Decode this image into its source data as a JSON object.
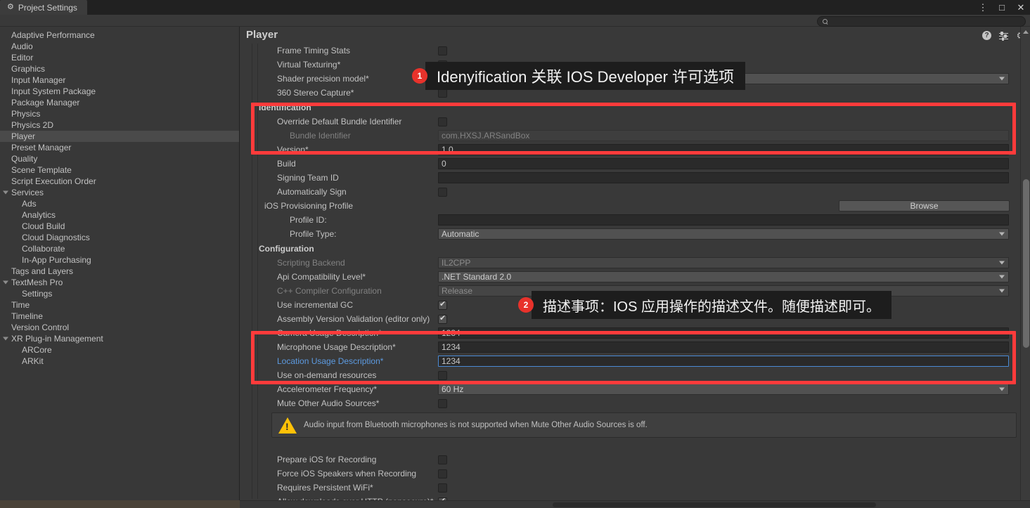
{
  "window": {
    "tab_label": "Project Settings",
    "tab_icon": "gear-icon",
    "menu_icon": "⋮",
    "maximize_icon": "□",
    "close_icon": "✕"
  },
  "search": {
    "value": "",
    "placeholder": "",
    "icon": "search-icon"
  },
  "sidebar": {
    "items": [
      {
        "label": "Adaptive Performance",
        "level": 0,
        "selected": false,
        "expandable": false
      },
      {
        "label": "Audio",
        "level": 0,
        "selected": false,
        "expandable": false
      },
      {
        "label": "Editor",
        "level": 0,
        "selected": false,
        "expandable": false
      },
      {
        "label": "Graphics",
        "level": 0,
        "selected": false,
        "expandable": false
      },
      {
        "label": "Input Manager",
        "level": 0,
        "selected": false,
        "expandable": false
      },
      {
        "label": "Input System Package",
        "level": 0,
        "selected": false,
        "expandable": false
      },
      {
        "label": "Package Manager",
        "level": 0,
        "selected": false,
        "expandable": false
      },
      {
        "label": "Physics",
        "level": 0,
        "selected": false,
        "expandable": false
      },
      {
        "label": "Physics 2D",
        "level": 0,
        "selected": false,
        "expandable": false
      },
      {
        "label": "Player",
        "level": 0,
        "selected": true,
        "expandable": false
      },
      {
        "label": "Preset Manager",
        "level": 0,
        "selected": false,
        "expandable": false
      },
      {
        "label": "Quality",
        "level": 0,
        "selected": false,
        "expandable": false
      },
      {
        "label": "Scene Template",
        "level": 0,
        "selected": false,
        "expandable": false
      },
      {
        "label": "Script Execution Order",
        "level": 0,
        "selected": false,
        "expandable": false
      },
      {
        "label": "Services",
        "level": 0,
        "selected": false,
        "expandable": true
      },
      {
        "label": "Ads",
        "level": 1,
        "selected": false,
        "expandable": false
      },
      {
        "label": "Analytics",
        "level": 1,
        "selected": false,
        "expandable": false
      },
      {
        "label": "Cloud Build",
        "level": 1,
        "selected": false,
        "expandable": false
      },
      {
        "label": "Cloud Diagnostics",
        "level": 1,
        "selected": false,
        "expandable": false
      },
      {
        "label": "Collaborate",
        "level": 1,
        "selected": false,
        "expandable": false
      },
      {
        "label": "In-App Purchasing",
        "level": 1,
        "selected": false,
        "expandable": false
      },
      {
        "label": "Tags and Layers",
        "level": 0,
        "selected": false,
        "expandable": false
      },
      {
        "label": "TextMesh Pro",
        "level": 0,
        "selected": false,
        "expandable": true
      },
      {
        "label": "Settings",
        "level": 1,
        "selected": false,
        "expandable": false
      },
      {
        "label": "Time",
        "level": 0,
        "selected": false,
        "expandable": false
      },
      {
        "label": "Timeline",
        "level": 0,
        "selected": false,
        "expandable": false
      },
      {
        "label": "Version Control",
        "level": 0,
        "selected": false,
        "expandable": false
      },
      {
        "label": "XR Plug-in Management",
        "level": 0,
        "selected": false,
        "expandable": true
      },
      {
        "label": "ARCore",
        "level": 1,
        "selected": false,
        "expandable": false
      },
      {
        "label": "ARKit",
        "level": 1,
        "selected": false,
        "expandable": false
      }
    ]
  },
  "panel": {
    "title": "Player",
    "help_icon": "?",
    "help_icon_name": "help-icon",
    "preset_icon_name": "preset-sliders-icon",
    "gear_icon": "⚙",
    "gear_icon_name": "settings-gear-icon"
  },
  "rows": {
    "frame_timing_stats": "Frame Timing Stats",
    "virtual_texturing": "Virtual Texturing*",
    "shader_precision_model": "Shader precision model*",
    "stereo_360_capture": "360 Stereo Capture*",
    "identification_header": "Identification",
    "override_bundle_id": "Override Default Bundle Identifier",
    "bundle_identifier": "Bundle Identifier",
    "bundle_identifier_value": "com.HXSJ.ARSandBox",
    "version": "Version*",
    "version_value": "1.0",
    "build": "Build",
    "build_value": "0",
    "signing_team_id": "Signing Team ID",
    "signing_team_id_value": "",
    "automatically_sign": "Automatically Sign",
    "ios_provisioning_profile": "iOS Provisioning Profile",
    "browse_button": "Browse",
    "profile_id": "Profile ID:",
    "profile_id_value": "",
    "profile_type": "Profile Type:",
    "profile_type_value": "Automatic",
    "configuration_header": "Configuration",
    "scripting_backend": "Scripting Backend",
    "scripting_backend_value": "IL2CPP",
    "api_compat_level": "Api Compatibility Level*",
    "api_compat_level_value": ".NET Standard 2.0",
    "cpp_compiler_config": "C++ Compiler Configuration",
    "cpp_compiler_config_value": "Release",
    "use_incremental_gc": "Use incremental GC",
    "assembly_version_validation": "Assembly Version Validation (editor only)",
    "camera_usage": "Camera Usage Description*",
    "camera_usage_value": "1234",
    "microphone_usage": "Microphone Usage Description*",
    "microphone_usage_value": "1234",
    "location_usage": "Location Usage Description*",
    "location_usage_value": "1234",
    "use_on_demand_resources": "Use on-demand resources",
    "accelerometer_frequency": "Accelerometer Frequency*",
    "accelerometer_frequency_value": "60 Hz",
    "mute_other_audio": "Mute Other Audio Sources*",
    "audio_warning": "Audio input from Bluetooth microphones is not supported when Mute Other Audio Sources is off.",
    "prepare_ios_recording": "Prepare iOS for Recording",
    "force_ios_speakers": "Force iOS Speakers when Recording",
    "requires_persistent_wifi": "Requires Persistent WiFi*",
    "allow_http_downloads": "Allow downloads over HTTP (nonsecure)*"
  },
  "callouts": [
    {
      "number": "1",
      "text": "Idenyification 关联 IOS Developer 许可选项"
    },
    {
      "number": "2",
      "text": "描述事项：IOS 应用操作的描述文件。随便描述即可。"
    }
  ],
  "colors": {
    "accent_red": "#ff3b3b",
    "callout_badge": "#e8322b",
    "focus_blue": "#5c9ae0",
    "warning_yellow": "#ffc107",
    "panel_bg": "#393939",
    "sidebar_selected": "#4a4a4a"
  }
}
